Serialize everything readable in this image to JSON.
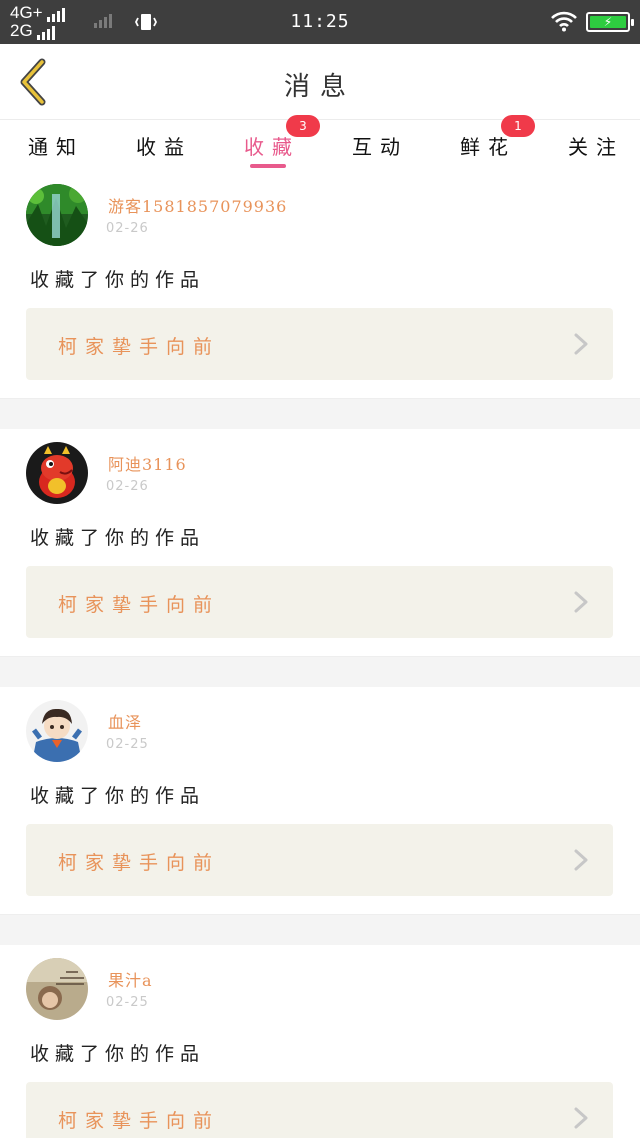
{
  "status_bar": {
    "network_1": "4G+",
    "network_2": "2G",
    "time": "11:25",
    "battery_icon": "battery-charging-icon",
    "wifi_icon": "wifi-icon",
    "vibrate_icon": "vibrate-icon"
  },
  "header": {
    "title": "消息",
    "back_icon": "back-arrow-icon"
  },
  "tabs": [
    {
      "label": "通知"
    },
    {
      "label": "收益"
    },
    {
      "label": "收藏",
      "badge": "3",
      "active": true
    },
    {
      "label": "互动"
    },
    {
      "label": "鲜花",
      "badge": "1"
    },
    {
      "label": "关注"
    }
  ],
  "notifications": [
    {
      "username": "游客15818570799​36",
      "date": "02-26",
      "action": "收藏了你的作品",
      "work_title": "柯家挚手向前",
      "avatar": "forest-avatar"
    },
    {
      "username": "阿迪3116",
      "date": "02-26",
      "action": "收藏了你的作品",
      "work_title": "柯家挚手向前",
      "avatar": "red-dragon-avatar"
    },
    {
      "username": "血泽",
      "date": "02-25",
      "action": "收藏了你的作品",
      "work_title": "柯家挚手向前",
      "avatar": "anime-boy-avatar"
    },
    {
      "username": "果汁a",
      "date": "02-25",
      "action": "收藏了你的作品",
      "work_title": "柯家挚手向前",
      "avatar": "girl-photo-avatar"
    }
  ],
  "colors": {
    "accent_pink": "#e85a8c",
    "badge_red": "#f03a4a",
    "name_orange": "#e8935a",
    "card_bg": "#f3f2ea",
    "back_yellow": "#e8c23a"
  }
}
